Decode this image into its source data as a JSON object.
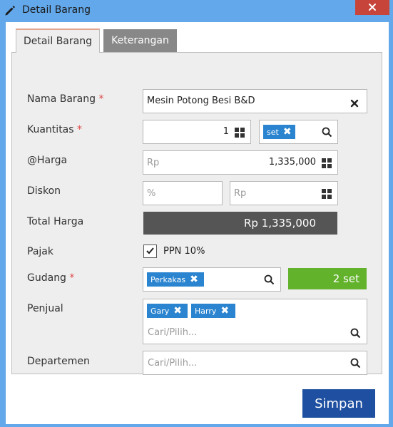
{
  "window": {
    "title": "Detail Barang",
    "close_icon": "close-icon"
  },
  "tabs": [
    {
      "label": "Detail Barang",
      "active": true
    },
    {
      "label": "Keterangan",
      "active": false
    }
  ],
  "form": {
    "nama_barang": {
      "label": "Nama Barang",
      "required_mark": "*",
      "value": "Mesin Potong Besi B&D"
    },
    "kuantitas": {
      "label": "Kuantitas",
      "required_mark": "*",
      "value": "1",
      "unit_tag": "set"
    },
    "harga": {
      "label": "@Harga",
      "prefix": "Rp",
      "value": "1,335,000"
    },
    "diskon": {
      "label": "Diskon",
      "percent_placeholder": "%",
      "amount_placeholder": "Rp"
    },
    "total_harga": {
      "label": "Total Harga",
      "value": "Rp 1,335,000"
    },
    "pajak": {
      "label": "Pajak",
      "checkbox_label": "PPN 10%",
      "checked": true
    },
    "gudang": {
      "label": "Gudang",
      "required_mark": "*",
      "tag": "Perkakas",
      "stock": "2 set"
    },
    "penjual": {
      "label": "Penjual",
      "tags": [
        "Gary",
        "Harry"
      ],
      "placeholder": "Cari/Pilih..."
    },
    "departemen": {
      "label": "Departemen",
      "placeholder": "Cari/Pilih..."
    }
  },
  "footer": {
    "save_label": "Simpan"
  },
  "colors": {
    "titlebar": "#62a8ea",
    "close": "#c7443b",
    "tag": "#2a84cf",
    "total": "#555555",
    "stock": "#62b22c",
    "save": "#1e4fa0"
  }
}
